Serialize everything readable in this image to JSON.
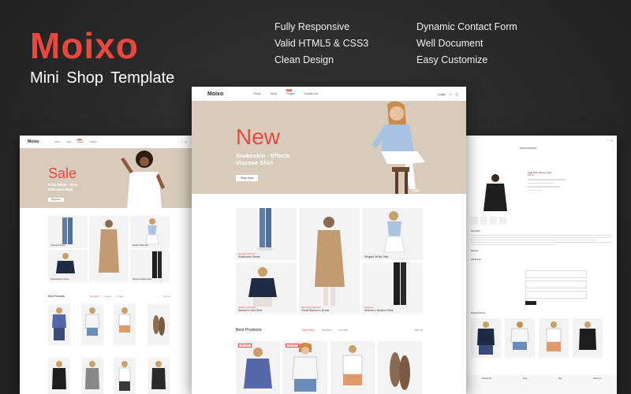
{
  "brand": {
    "name": "Moixo",
    "subtitle": "Mini  Shop Template"
  },
  "features": [
    "Fully Responsive",
    "Dynamic Contact Form",
    "Valid HTML5 & CSS3",
    "Well Document",
    "Clean Design",
    "Easy Customize"
  ],
  "colors": {
    "accent": "#e8493f",
    "hero_bg": "#d8cbbb",
    "page_bg": "#2a2a2a"
  },
  "center": {
    "nav": {
      "logo": "Moixo",
      "links": [
        "Home",
        "Shop",
        "Pages",
        "Contact Us"
      ],
      "badge": "New",
      "login": "Login",
      "search_icon": "search-icon",
      "cart_icon": "cart-icon",
      "cart_count": "0"
    },
    "hero": {
      "headline": "New",
      "subline1": "Snakeskin - Effects",
      "subline2": "Viscose Shirt",
      "button": "Shop Now"
    },
    "tiles": [
      {
        "category": "Spring Collection",
        "name": "Snakeskin Shoes"
      },
      {
        "category": "Morning Collection",
        "name": "Floral Women's Dress"
      },
      {
        "category": "",
        "name": "Elegant White Skirt"
      },
      {
        "category": "Winter Collection",
        "name": "Women's Knit Shirt"
      },
      {
        "category": "Features",
        "name": "Women's Modern Pant"
      }
    ],
    "best": {
      "title": "Best Products",
      "tabs": [
        "Best Seller",
        "Featured",
        "On Sale"
      ],
      "active_tab": 0,
      "view_all": "View All",
      "tags": [
        "New Sale",
        "New Sale"
      ]
    }
  },
  "left": {
    "nav": {
      "logo": "Moixo",
      "links": [
        "Home",
        "Shop",
        "Pages",
        "Contact"
      ],
      "badge": "New"
    },
    "hero": {
      "headline": "Sale",
      "subline1": "Frida White - Shirt",
      "subline2": "2022 Best Style",
      "button": "Shop Now"
    },
    "tiles": [
      {
        "category": "",
        "name": "Snakeskin Shoes"
      },
      {
        "category": "",
        "name": ""
      },
      {
        "category": "",
        "name": "Elegant White Skirt"
      },
      {
        "category": "",
        "name": "Floral Women's Dress"
      },
      {
        "category": "",
        "name": "Women's Modern Pant"
      }
    ],
    "best": {
      "title": "Best Products",
      "tabs": [
        "Best Seller",
        "Featured",
        "On Sale"
      ],
      "view_all": "View All"
    }
  },
  "right": {
    "page_title": "SHOP DETAILS",
    "product_name": "High Rise Skinny Jean",
    "price": "$39.00",
    "description_label": "Description",
    "reviews_label": "Reviews",
    "add_review_label": "Add Review",
    "related_label": "Related Products",
    "footer_cols": [
      "Contact Info",
      "Shop",
      "Help",
      "Follow Us"
    ]
  }
}
